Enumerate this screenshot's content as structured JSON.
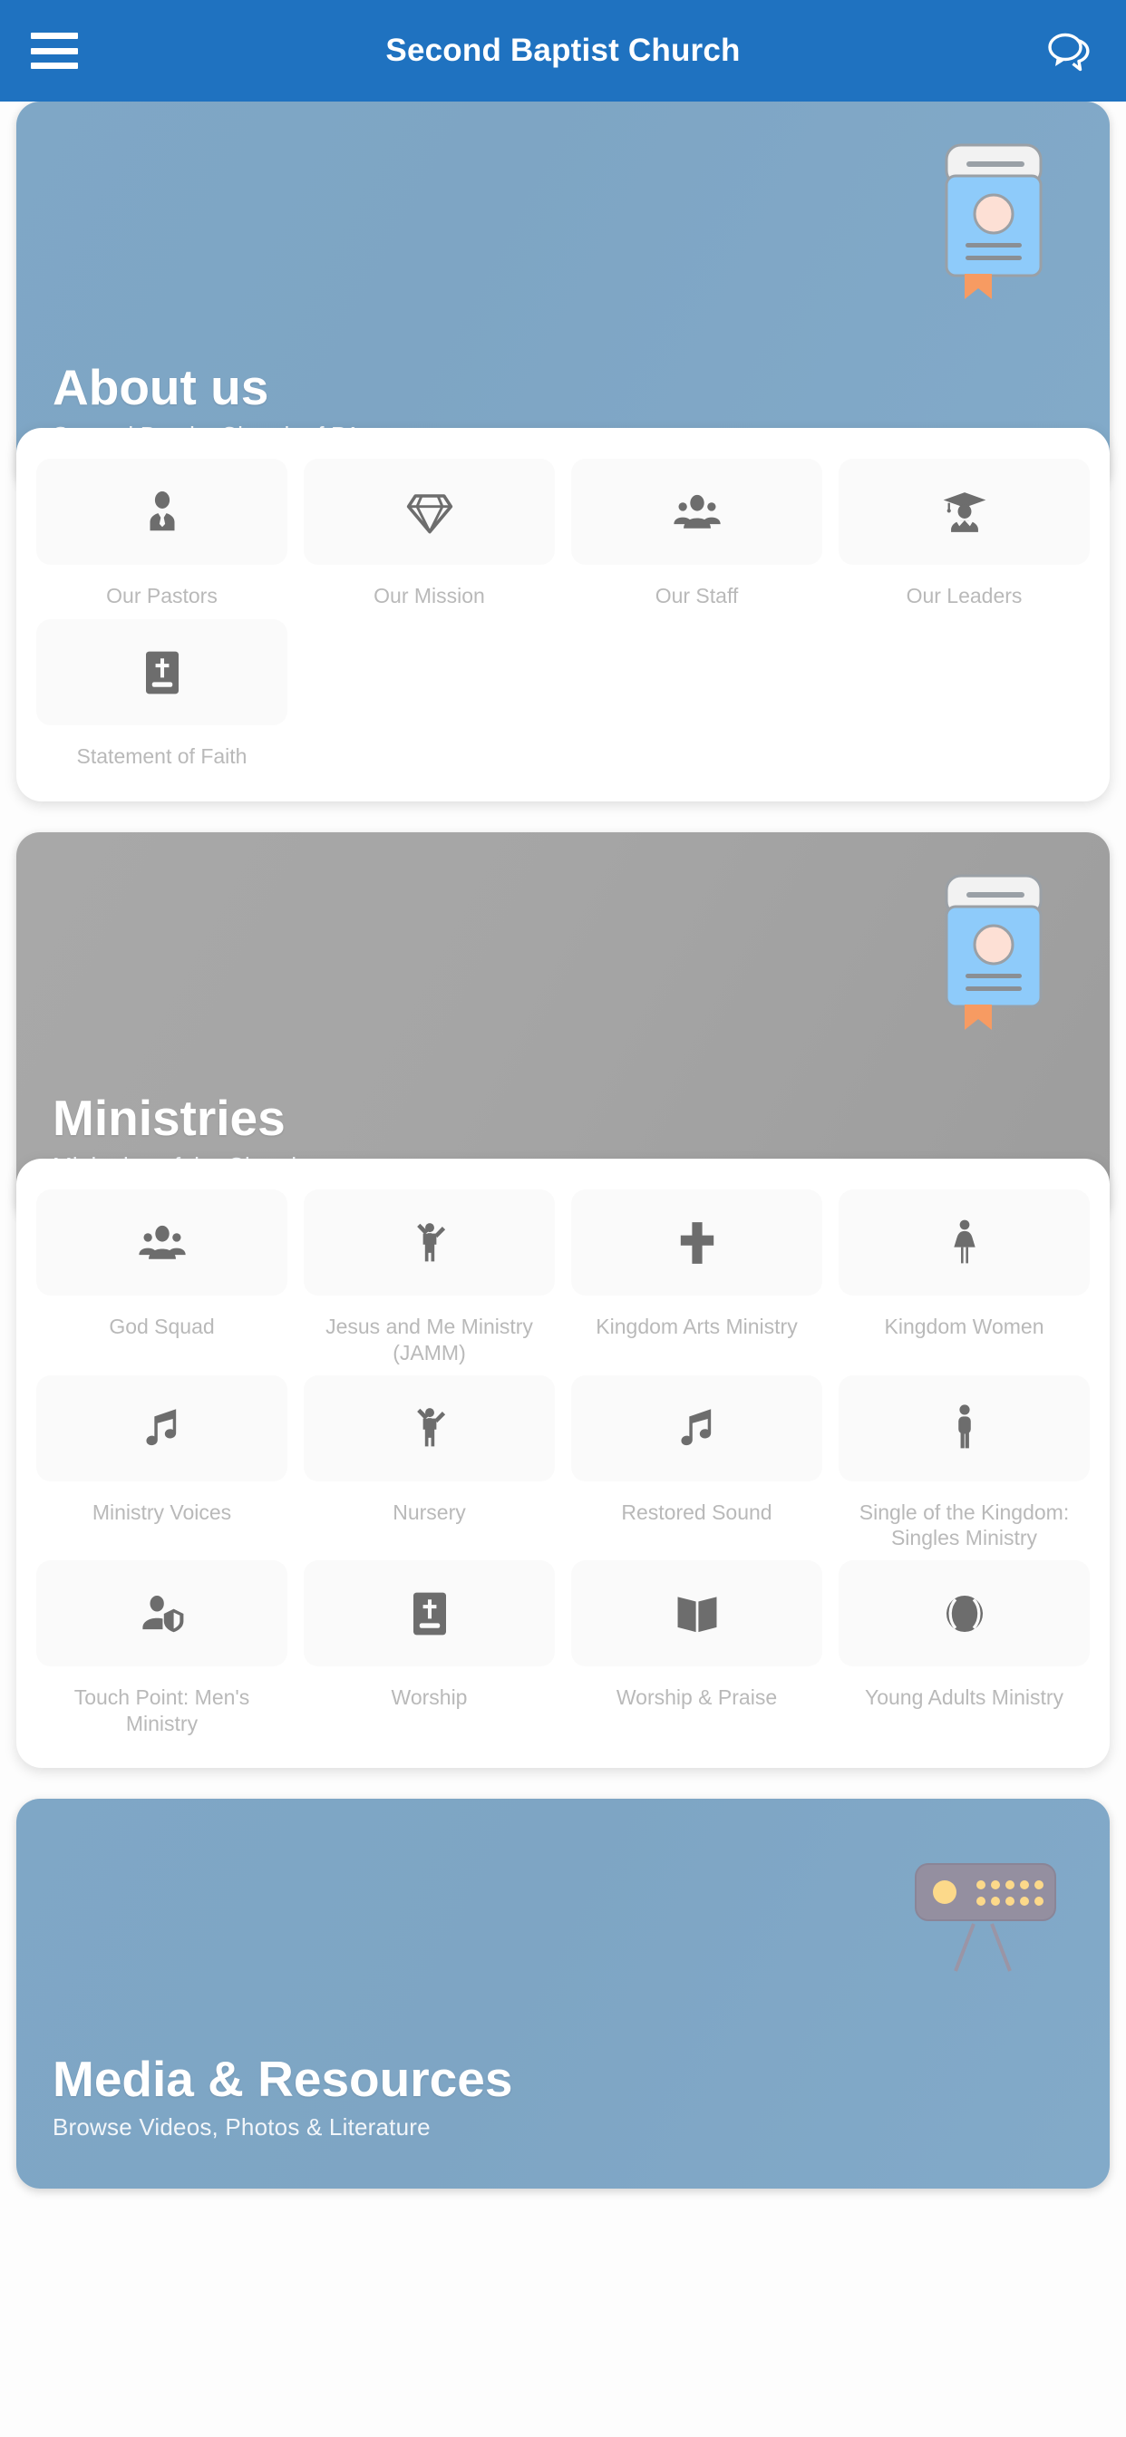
{
  "appbar": {
    "title": "Second Baptist Church",
    "menu_icon": "hamburger-menu-icon",
    "chat_icon": "chat-bubbles-icon",
    "background_color": "#1f72c0"
  },
  "sections": [
    {
      "key": "about",
      "title": "About us",
      "subtitle": "Second Baptist Church of PA",
      "art": "book-illustration",
      "accent_color": "#7fa7c6",
      "tiles": [
        {
          "label": "Our Pastors",
          "icon": "person-in-tie-icon"
        },
        {
          "label": "Our Mission",
          "icon": "diamond-gem-icon"
        },
        {
          "label": "Our Staff",
          "icon": "people-group-icon"
        },
        {
          "label": "Our Leaders",
          "icon": "graduate-cap-person-icon"
        },
        {
          "label": "Statement of Faith",
          "icon": "bible-cross-icon"
        }
      ]
    },
    {
      "key": "ministries",
      "title": "Ministries",
      "subtitle": "Ministries of the Church",
      "art": "book-illustration",
      "accent_color": "#a5a5a5",
      "tiles": [
        {
          "label": "God Squad",
          "icon": "people-group-icon"
        },
        {
          "label": "Jesus and Me Ministry (JAMM)",
          "icon": "child-raised-arms-icon"
        },
        {
          "label": "Kingdom Arts Ministry",
          "icon": "cross-icon"
        },
        {
          "label": "Kingdom Women",
          "icon": "woman-icon"
        },
        {
          "label": "Ministry Voices",
          "icon": "music-note-icon"
        },
        {
          "label": "Nursery",
          "icon": "child-raised-arms-icon"
        },
        {
          "label": "Restored Sound",
          "icon": "music-note-icon"
        },
        {
          "label": "Single of the Kingdom: Singles Ministry",
          "icon": "person-standing-icon"
        },
        {
          "label": "Touch Point: Men's Ministry",
          "icon": "person-shield-icon"
        },
        {
          "label": "Worship",
          "icon": "bible-cross-icon"
        },
        {
          "label": "Worship & Praise",
          "icon": "open-book-icon"
        },
        {
          "label": "Young Adults Ministry",
          "icon": "baseball-icon"
        }
      ]
    },
    {
      "key": "media",
      "title": "Media & Resources",
      "subtitle": "Browse Videos, Photos & Literature",
      "art": "stage-light-illustration",
      "accent_color": "#7fa7c6",
      "tiles": []
    }
  ]
}
